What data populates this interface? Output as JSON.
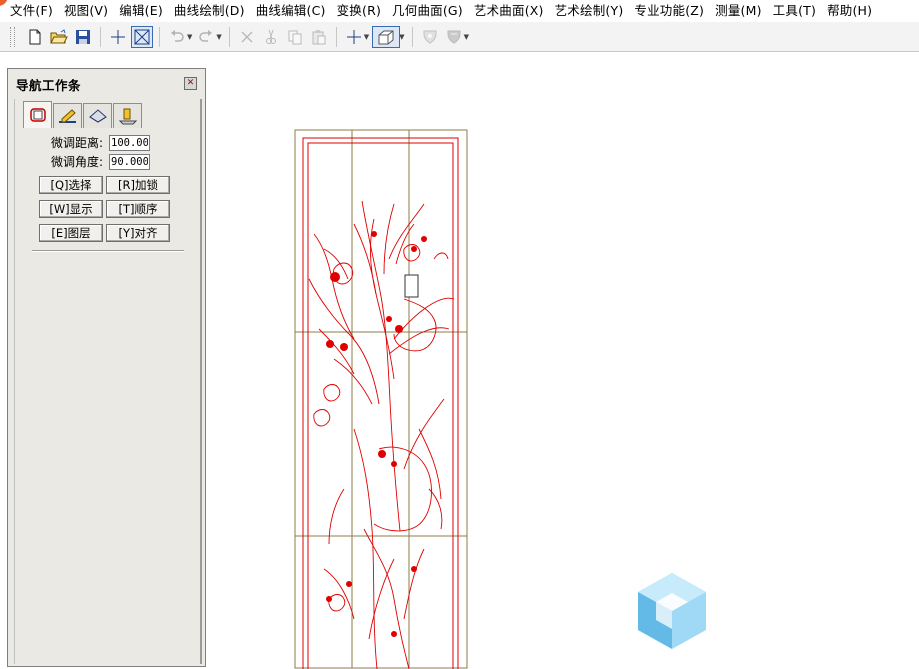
{
  "menu": [
    "文件(F)",
    "视图(V)",
    "编辑(E)",
    "曲线绘制(D)",
    "曲线编辑(C)",
    "变换(R)",
    "几何曲面(G)",
    "艺术曲面(X)",
    "艺术绘制(Y)",
    "专业功能(Z)",
    "测量(M)",
    "工具(T)",
    "帮助(H)"
  ],
  "toolbar": {
    "icons": [
      "new-file-icon",
      "open-folder-icon",
      "save-icon",
      "crosshair-icon",
      "zoom-box-icon",
      "undo-icon",
      "redo-icon",
      "cut-x-icon",
      "scissors-icon",
      "copy-icon",
      "paste-icon",
      "snap-crosshair-icon",
      "view-cube-icon",
      "shield-outline-icon",
      "shield-filled-icon"
    ]
  },
  "nav": {
    "title": "导航工作条",
    "close": "✕",
    "tabs": [
      "window-tab-icon",
      "pencil-tab-icon",
      "plane-tab-icon",
      "tool-tab-icon"
    ],
    "fine_distance_label": "微调距离:",
    "fine_distance_value": "100.00",
    "fine_angle_label": "微调角度:",
    "fine_angle_value": "90.000",
    "buttons": {
      "select": "[Q]选择",
      "lock": "[R]加锁",
      "show": "[W]显示",
      "order": "[T]顺序",
      "layer": "[E]图层",
      "align": "[Y]对齐"
    }
  },
  "colors": {
    "frame": "#8b7d45",
    "drawing": "#e00000",
    "panel_bg": "#ebe9e4",
    "watermark": "#7cc8ef"
  }
}
